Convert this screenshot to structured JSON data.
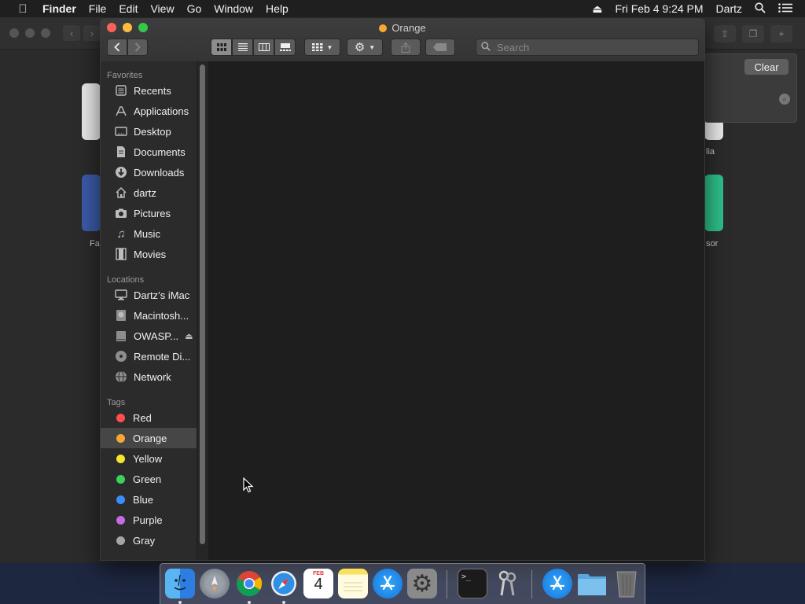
{
  "menubar": {
    "app": "Finder",
    "menus": [
      "File",
      "Edit",
      "View",
      "Go",
      "Window",
      "Help"
    ],
    "datetime": "Fri Feb 4  9:24 PM",
    "user": "Dartz"
  },
  "background_window": {
    "clear_label": "Clear",
    "label_left_2": "Fa",
    "label_right_1": "lia",
    "label_right_2": "sor"
  },
  "finder": {
    "title": "Orange",
    "title_dot_color": "#f7a733",
    "search_placeholder": "Search"
  },
  "sidebar": {
    "favorites_header": "Favorites",
    "favorites": [
      {
        "label": "Recents",
        "icon": "recents-icon"
      },
      {
        "label": "Applications",
        "icon": "applications-icon"
      },
      {
        "label": "Desktop",
        "icon": "desktop-icon"
      },
      {
        "label": "Documents",
        "icon": "documents-icon"
      },
      {
        "label": "Downloads",
        "icon": "downloads-icon"
      },
      {
        "label": "dartz",
        "icon": "home-icon"
      },
      {
        "label": "Pictures",
        "icon": "pictures-icon"
      },
      {
        "label": "Music",
        "icon": "music-icon"
      },
      {
        "label": "Movies",
        "icon": "movies-icon"
      }
    ],
    "locations_header": "Locations",
    "locations": [
      {
        "label": "Dartz’s iMac",
        "icon": "imac-icon"
      },
      {
        "label": "Macintosh...",
        "icon": "hard-drive-icon"
      },
      {
        "label": "OWASP...",
        "icon": "drive-icon"
      },
      {
        "label": "Remote Di...",
        "icon": "remote-disc-icon"
      },
      {
        "label": "Network",
        "icon": "network-icon"
      }
    ],
    "tags_header": "Tags",
    "tags": [
      {
        "label": "Red",
        "color": "#fc4f4f"
      },
      {
        "label": "Orange",
        "color": "#f7a733"
      },
      {
        "label": "Yellow",
        "color": "#f6e431"
      },
      {
        "label": "Green",
        "color": "#3ed15a"
      },
      {
        "label": "Blue",
        "color": "#3b8dfb"
      },
      {
        "label": "Purple",
        "color": "#c46be6"
      },
      {
        "label": "Gray",
        "color": "#a6a6a6"
      }
    ],
    "selected_tag": "Orange"
  },
  "dock": {
    "apps": [
      "finder-icon",
      "launchpad-icon",
      "chrome-icon",
      "safari-icon",
      "calendar-icon",
      "notes-icon",
      "app-store-icon",
      "system-preferences-icon",
      "terminal-icon",
      "keychain-access-icon",
      "app-store-folder-icon",
      "folder-icon",
      "trash-icon"
    ],
    "calendar_month": "FEB",
    "calendar_day": "4"
  }
}
